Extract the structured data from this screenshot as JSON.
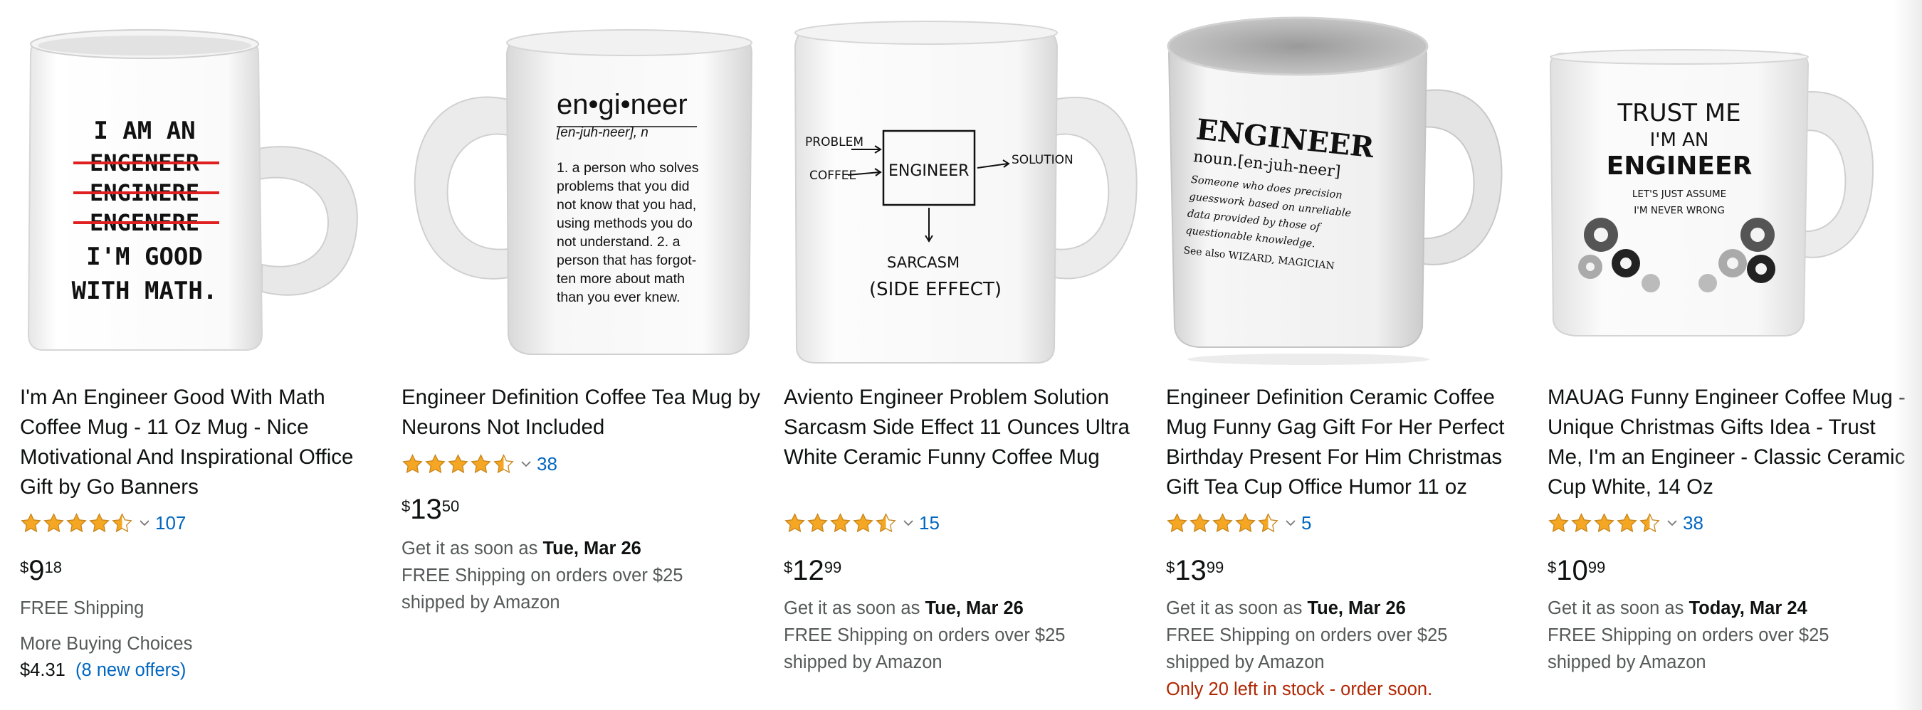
{
  "products": [
    {
      "title": "I'm An Engineer Good With Math Coffee Mug - 11 Oz Mug - Nice Motivational And Inspirational Office Gift by Go Banners",
      "rating": 4.5,
      "rating_count": "107",
      "price": {
        "symbol": "$",
        "whole": "9",
        "fraction": "18"
      },
      "shipping": "FREE Shipping",
      "more_choices_label": "More Buying Choices",
      "more_choices_price": "$4.31",
      "more_choices_link": "(8 new offers)",
      "image_text": [
        "I AM AN",
        "ENGENEER",
        "ENGINERE",
        "ENGENERE",
        "I'M GOOD",
        "WITH MATH."
      ]
    },
    {
      "title": "Engineer Definition Coffee Tea Mug by Neurons Not Included",
      "rating": 4.5,
      "rating_count": "38",
      "price": {
        "symbol": "$",
        "whole": "13",
        "fraction": "50"
      },
      "delivery_prefix": "Get it as soon as ",
      "delivery_date": "Tue, Mar 26",
      "shipping": "FREE Shipping on orders over $25",
      "shipped_by": "shipped by Amazon",
      "image_text": [
        "en•gi•neer",
        "[en-juh-neer], n",
        "1. a person who solves",
        "problems that you did",
        "not know that you had,",
        "using methods you do",
        "not understand.  2. a",
        "person that has forgot-",
        "ten more about math",
        "than you ever knew."
      ]
    },
    {
      "title": "Aviento Engineer Problem Solution Sarcasm Side Effect 11 Ounces Ultra White Ceramic Funny Coffee Mug",
      "rating": 4.5,
      "rating_count": "15",
      "price": {
        "symbol": "$",
        "whole": "12",
        "fraction": "99"
      },
      "delivery_prefix": "Get it as soon as ",
      "delivery_date": "Tue, Mar 26",
      "shipping": "FREE Shipping on orders over $25",
      "shipped_by": "shipped by Amazon",
      "image_text": [
        "PROBLEM",
        "COFFEE",
        "ENGINEER",
        "SOLUTION",
        "SARCASM",
        "(SIDE EFFECT)"
      ]
    },
    {
      "title": "Engineer Definition Ceramic Coffee Mug Funny Gag Gift For Her Perfect Birthday Present For Him Christmas Gift Tea Cup Office Humor 11 oz",
      "rating": 4.5,
      "rating_count": "5",
      "price": {
        "symbol": "$",
        "whole": "13",
        "fraction": "99"
      },
      "delivery_prefix": "Get it as soon as ",
      "delivery_date": "Tue, Mar 26",
      "shipping": "FREE Shipping on orders over $25",
      "shipped_by": "shipped by Amazon",
      "stock": "Only 20 left in stock - order soon.",
      "image_text": [
        "ENGINEER",
        "noun.[en-juh-neer]",
        "Someone who does precision",
        "guesswork based on unreliable",
        "data provided by those of",
        "questionable knowledge.",
        "See also WIZARD, MAGICIAN"
      ]
    },
    {
      "title": "MAUAG Funny Engineer Coffee Mug - Unique Christmas Gifts Idea - Trust Me, I'm an Engineer - Classic Ceramic Cup White, 14 Oz",
      "rating": 4.5,
      "rating_count": "38",
      "price": {
        "symbol": "$",
        "whole": "10",
        "fraction": "99"
      },
      "delivery_prefix": "Get it as soon as ",
      "delivery_date": "Today, Mar 24",
      "shipping": "FREE Shipping on orders over $25",
      "shipped_by": "shipped by Amazon",
      "image_text": [
        "TRUST ME",
        "I'M AN",
        "ENGINEER",
        "LET'S JUST ASSUME",
        "I'M NEVER WRONG"
      ]
    }
  ],
  "colors": {
    "link": "#0066c0",
    "star": "#f5a623",
    "price": "#0f1111",
    "muted": "#565959",
    "stock": "#b12704"
  },
  "icons": {
    "star": "star-icon",
    "half_star": "half-star-icon",
    "chevron": "chevron-down-icon"
  }
}
